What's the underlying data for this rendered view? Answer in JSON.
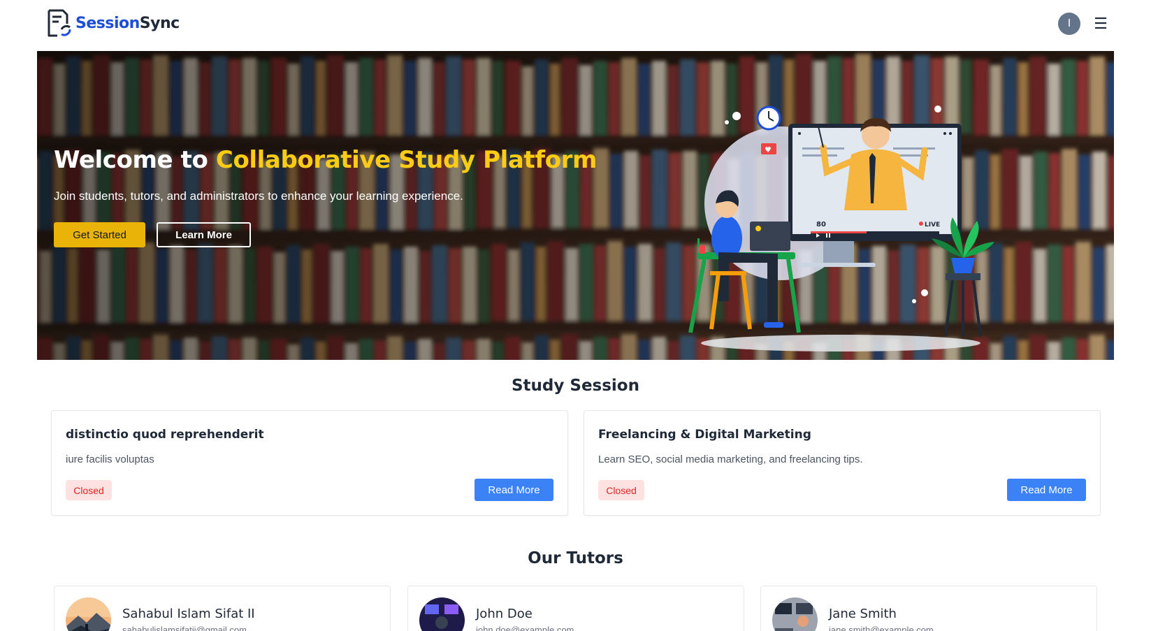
{
  "brand": {
    "name_part1": "Session",
    "name_part2": "Sync"
  },
  "nav": {
    "avatar_initial": "I",
    "menu_glyph": "☰"
  },
  "hero": {
    "title_prefix": "Welcome to",
    "title_accent": "Collaborative Study Platform",
    "subtitle": "Join students, tutors, and administrators to enhance your learning experience.",
    "primary_button": "Get Started",
    "secondary_button": "Learn More",
    "illustration": {
      "viewer_count": "80",
      "live_label": "LIVE"
    }
  },
  "study_sessions": {
    "heading": "Study Session",
    "items": [
      {
        "title": "distinctio quod reprehenderit",
        "description": "iure facilis voluptas",
        "status": "Closed",
        "button": "Read More"
      },
      {
        "title": "Freelancing & Digital Marketing",
        "description": "Learn SEO, social media marketing, and freelancing tips.",
        "status": "Closed",
        "button": "Read More"
      }
    ]
  },
  "tutors": {
    "heading": "Our Tutors",
    "items": [
      {
        "name": "Sahabul Islam Sifat II",
        "email": "sahabulislamsifatii@gmail.com"
      },
      {
        "name": "John Doe",
        "email": "john.doe@example.com"
      },
      {
        "name": "Jane Smith",
        "email": "jane.smith@example.com"
      }
    ]
  },
  "colors": {
    "brand_blue": "#1d4ed8",
    "accent_yellow": "#facc15",
    "button_yellow": "#eab308",
    "read_more_blue": "#3b82f6",
    "closed_badge_bg": "#fee2e2",
    "closed_badge_text": "#dc2626"
  }
}
